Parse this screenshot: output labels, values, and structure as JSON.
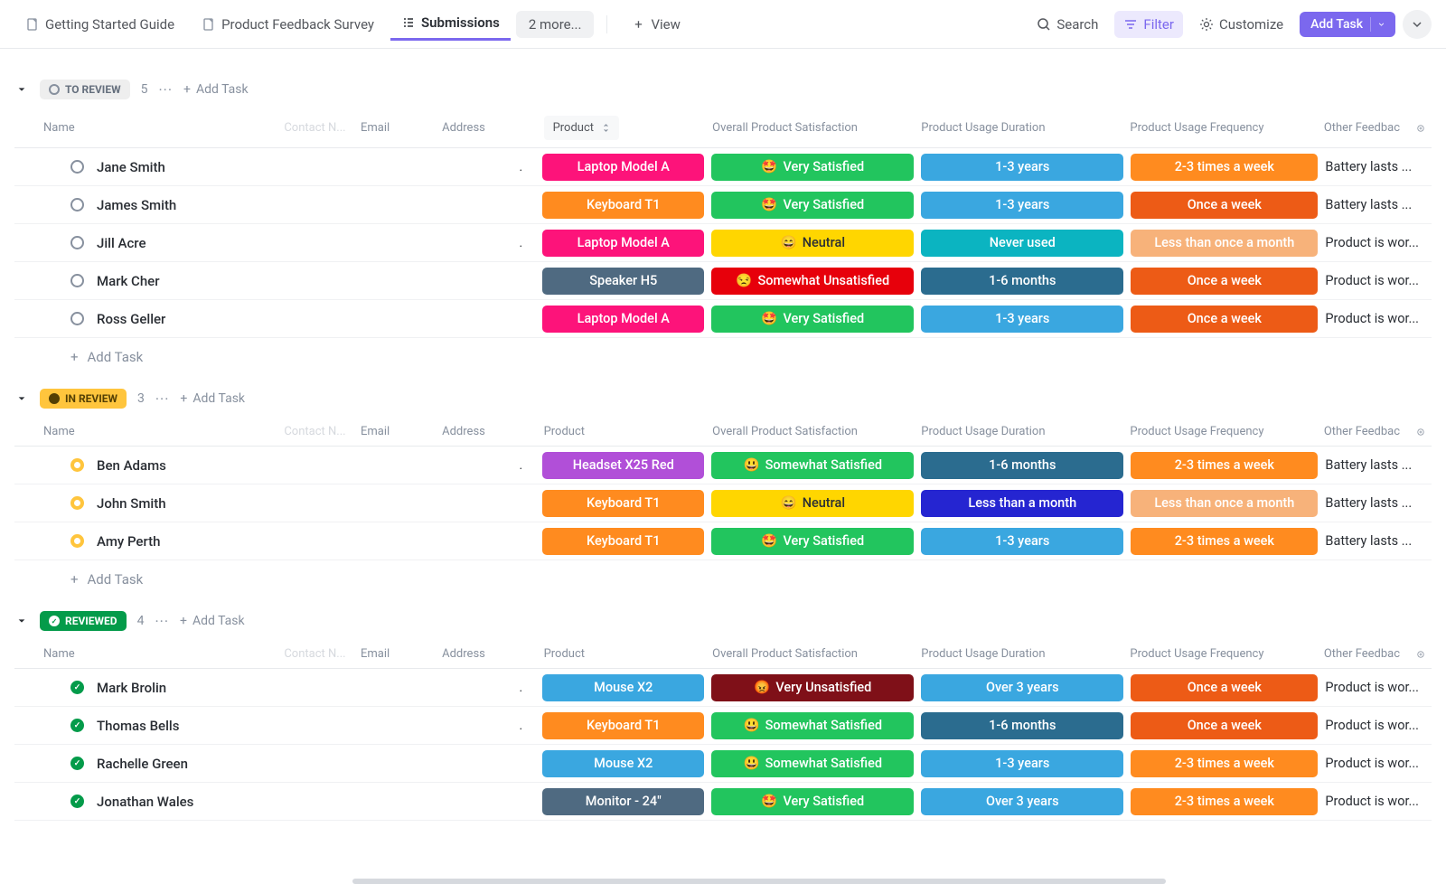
{
  "toolbar": {
    "tabs": [
      {
        "label": "Getting Started Guide",
        "icon": "doc"
      },
      {
        "label": "Product Feedback Survey",
        "icon": "doc"
      },
      {
        "label": "Submissions",
        "icon": "list",
        "active": true
      }
    ],
    "more": "2 more...",
    "add_view": "View",
    "search": "Search",
    "filter": "Filter",
    "customize": "Customize",
    "add_task": "Add Task"
  },
  "columns": {
    "name": "Name",
    "contact": "Contact N...",
    "email": "Email",
    "address": "Address",
    "product": "Product",
    "satisfaction": "Overall Product Satisfaction",
    "duration": "Product Usage Duration",
    "frequency": "Product Usage Frequency",
    "feedback": "Other Feedbac"
  },
  "add_task_inline": "Add Task",
  "colors": {
    "product": {
      "Laptop Model A": "#fd137a",
      "Keyboard T1": "#ff8b1f",
      "Speaker H5": "#4f6a81",
      "Headset X25 Red": "#b14fd8",
      "Mouse X2": "#3aa7e0",
      "Monitor - 24\"": "#4f6a81"
    },
    "satisfaction": {
      "Very Satisfied": {
        "bg": "#22c55e",
        "emoji": "🤩"
      },
      "Somewhat Satisfied": {
        "bg": "#22c55e",
        "emoji": "😃"
      },
      "Neutral": {
        "bg": "#ffd600",
        "emoji": "😄",
        "fg": "#2a2e34"
      },
      "Somewhat Unsatisfied": {
        "bg": "#e7000b",
        "emoji": "😒"
      },
      "Very Unsatisfied": {
        "bg": "#7f1018",
        "emoji": "😡"
      }
    },
    "duration": {
      "1-3 years": "#3aa7e0",
      "Never used": "#0bb4c1",
      "1-6 months": "#2b6c8f",
      "Less than a month": "#2525d1",
      "Over 3 years": "#3aa7e0"
    },
    "frequency": {
      "2-3 times a week": "#ff8b1f",
      "Once a week": "#ed5b16",
      "Less than once a month": "#f7b27a"
    }
  },
  "groups": [
    {
      "status": "TO REVIEW",
      "style": "toreview",
      "count": 5,
      "rows": [
        {
          "name": "Jane Smith",
          "addr": ".",
          "product": "Laptop Model A",
          "sat": "Very Satisfied",
          "dur": "1-3 years",
          "freq": "2-3 times a week",
          "fb": "Battery lasts ..."
        },
        {
          "name": "James Smith",
          "addr": "",
          "product": "Keyboard T1",
          "sat": "Very Satisfied",
          "dur": "1-3 years",
          "freq": "Once a week",
          "fb": "Battery lasts ..."
        },
        {
          "name": "Jill Acre",
          "addr": ".",
          "product": "Laptop Model A",
          "sat": "Neutral",
          "dur": "Never used",
          "freq": "Less than once a month",
          "fb": "Product is wor..."
        },
        {
          "name": "Mark Cher",
          "addr": "",
          "product": "Speaker H5",
          "sat": "Somewhat Unsatisfied",
          "dur": "1-6 months",
          "freq": "Once a week",
          "fb": "Product is wor..."
        },
        {
          "name": "Ross Geller",
          "addr": "",
          "product": "Laptop Model A",
          "sat": "Very Satisfied",
          "dur": "1-3 years",
          "freq": "Once a week",
          "fb": "Product is wor..."
        }
      ]
    },
    {
      "status": "IN REVIEW",
      "style": "inreview",
      "count": 3,
      "rows": [
        {
          "name": "Ben Adams",
          "addr": ".",
          "product": "Headset X25 Red",
          "sat": "Somewhat Satisfied",
          "dur": "1-6 months",
          "freq": "2-3 times a week",
          "fb": "Battery lasts ..."
        },
        {
          "name": "John Smith",
          "addr": "",
          "product": "Keyboard T1",
          "sat": "Neutral",
          "dur": "Less than a month",
          "freq": "Less than once a month",
          "fb": "Battery lasts ..."
        },
        {
          "name": "Amy Perth",
          "addr": "",
          "product": "Keyboard T1",
          "sat": "Very Satisfied",
          "dur": "1-3 years",
          "freq": "2-3 times a week",
          "fb": "Battery lasts ..."
        }
      ]
    },
    {
      "status": "REVIEWED",
      "style": "reviewed",
      "count": 4,
      "rows": [
        {
          "name": "Mark Brolin",
          "addr": ".",
          "product": "Mouse X2",
          "sat": "Very Unsatisfied",
          "dur": "Over 3 years",
          "freq": "Once a week",
          "fb": "Product is wor..."
        },
        {
          "name": "Thomas Bells",
          "addr": ".",
          "product": "Keyboard T1",
          "sat": "Somewhat Satisfied",
          "dur": "1-6 months",
          "freq": "Once a week",
          "fb": "Product is wor..."
        },
        {
          "name": "Rachelle Green",
          "addr": "",
          "product": "Mouse X2",
          "sat": "Somewhat Satisfied",
          "dur": "1-3 years",
          "freq": "2-3 times a week",
          "fb": "Product is wor..."
        },
        {
          "name": "Jonathan Wales",
          "addr": "",
          "product": "Monitor - 24\"",
          "sat": "Very Satisfied",
          "dur": "Over 3 years",
          "freq": "2-3 times a week",
          "fb": "Product is wor..."
        }
      ]
    }
  ]
}
